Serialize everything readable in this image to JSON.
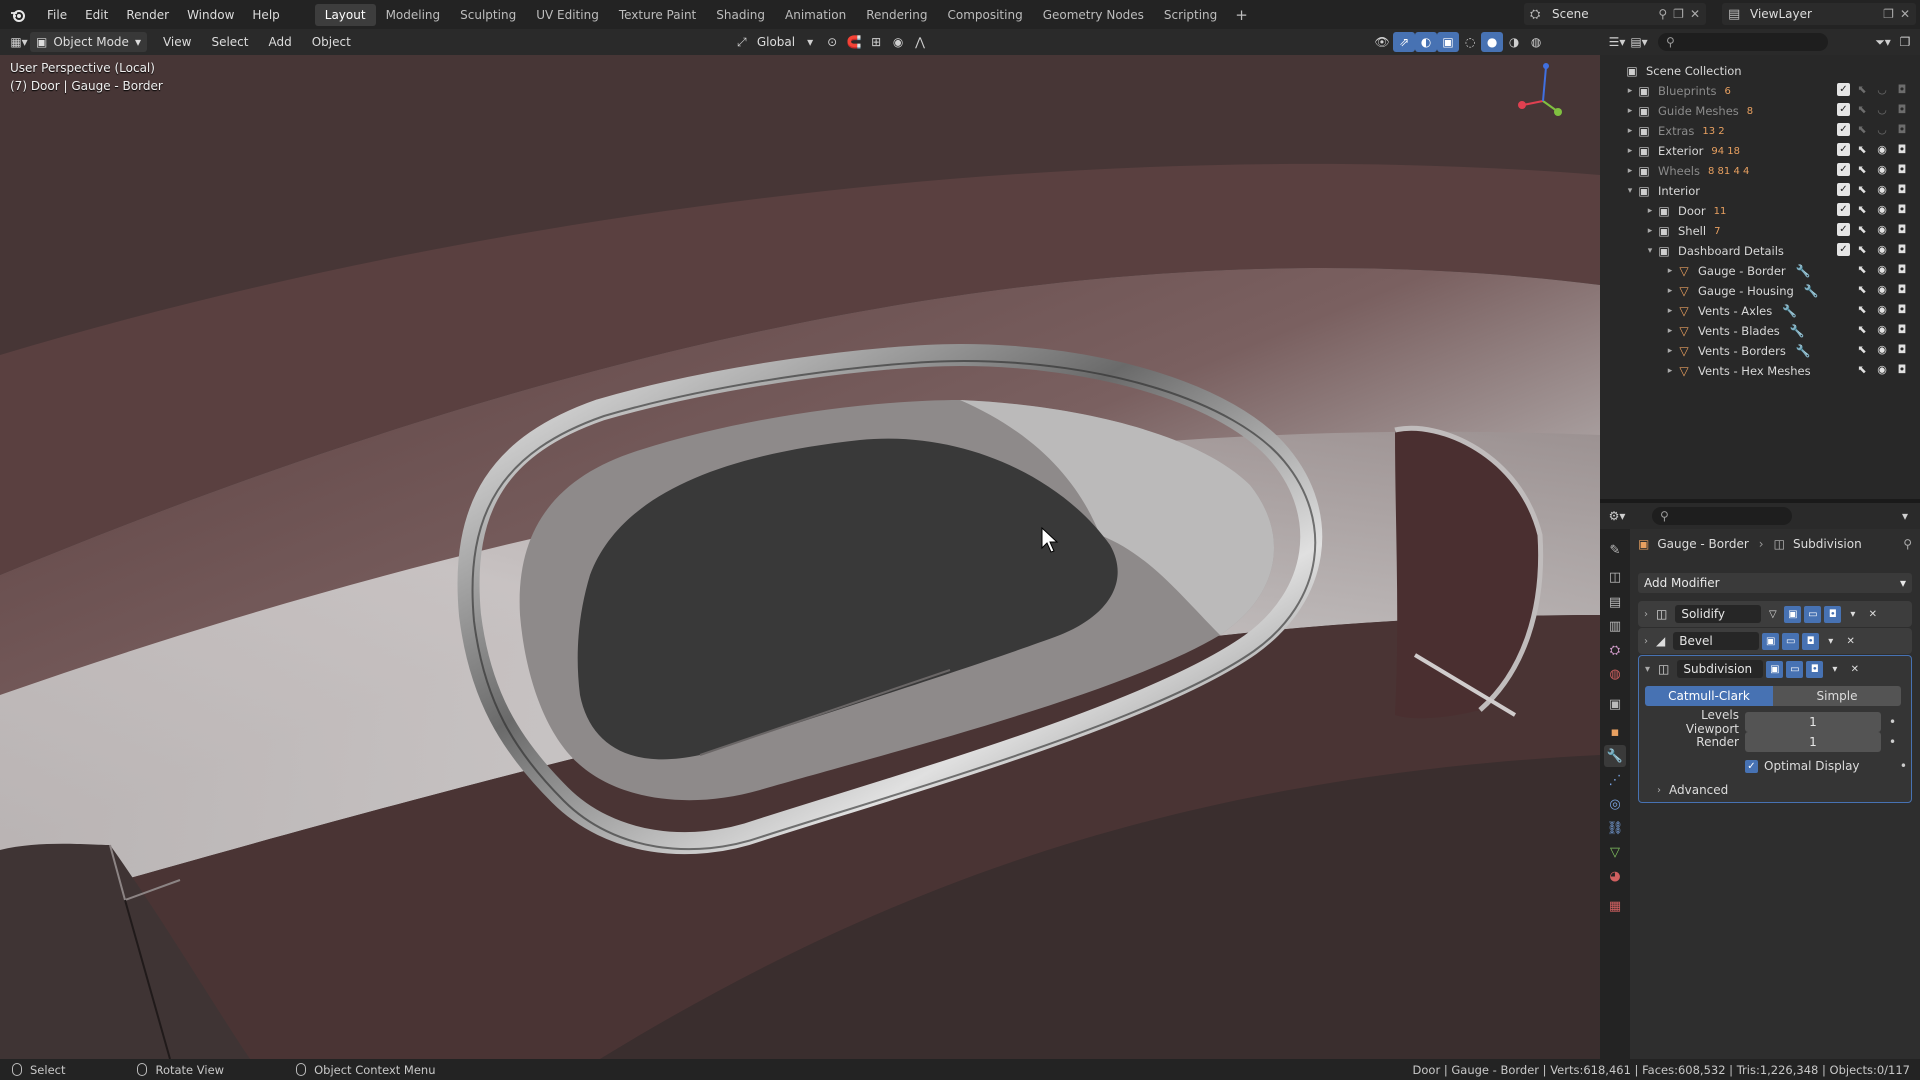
{
  "menu": [
    "File",
    "Edit",
    "Render",
    "Window",
    "Help"
  ],
  "workspaces": [
    "Layout",
    "Modeling",
    "Sculpting",
    "UV Editing",
    "Texture Paint",
    "Shading",
    "Animation",
    "Rendering",
    "Compositing",
    "Geometry Nodes",
    "Scripting"
  ],
  "active_workspace": "Layout",
  "scene": "Scene",
  "view_layer": "ViewLayer",
  "viewport_header": {
    "mode": "Object Mode",
    "menus": [
      "View",
      "Select",
      "Add",
      "Object"
    ],
    "transform_orientation": "Global"
  },
  "viewport": {
    "perspective_label": "User Perspective (Local)",
    "object_label": "(7) Door | Gauge - Border"
  },
  "outliner": {
    "root": "Scene Collection",
    "rows": [
      {
        "name": "Blueprints",
        "badge": "6"
      },
      {
        "name": "Guide Meshes",
        "badge": "8"
      },
      {
        "name": "Extras",
        "badge": "13 2"
      },
      {
        "name": "Exterior",
        "badge": "94 18"
      },
      {
        "name": "Wheels",
        "badge": "8 81 4 4"
      },
      {
        "name": "Interior",
        "badge": ""
      },
      {
        "name": "Door",
        "badge": "11"
      },
      {
        "name": "Shell",
        "badge": "7"
      },
      {
        "name": "Dashboard Details",
        "badge": ""
      },
      {
        "name": "Gauge - Border",
        "badge": ""
      },
      {
        "name": "Gauge - Housing",
        "badge": ""
      },
      {
        "name": "Vents - Axles",
        "badge": ""
      },
      {
        "name": "Vents - Blades",
        "badge": ""
      },
      {
        "name": "Vents - Borders",
        "badge": ""
      },
      {
        "name": "Vents - Hex Meshes",
        "badge": ""
      }
    ]
  },
  "properties": {
    "breadcrumb_object": "Gauge - Border",
    "breadcrumb_modifier": "Subdivision",
    "add_modifier": "Add Modifier",
    "modifiers": [
      "Solidify",
      "Bevel",
      "Subdivision"
    ],
    "subdivision": {
      "mode_a": "Catmull-Clark",
      "mode_b": "Simple",
      "levels_viewport_label": "Levels Viewport",
      "levels_viewport": "1",
      "render_label": "Render",
      "render": "1",
      "optimal_display": "Optimal Display",
      "advanced": "Advanced"
    }
  },
  "statusbar": {
    "select": "Select",
    "rotate": "Rotate View",
    "context": "Object Context Menu",
    "stats": "Door | Gauge - Border | Verts:618,461 | Faces:608,532 | Tris:1,226,348 | Objects:0/117"
  }
}
